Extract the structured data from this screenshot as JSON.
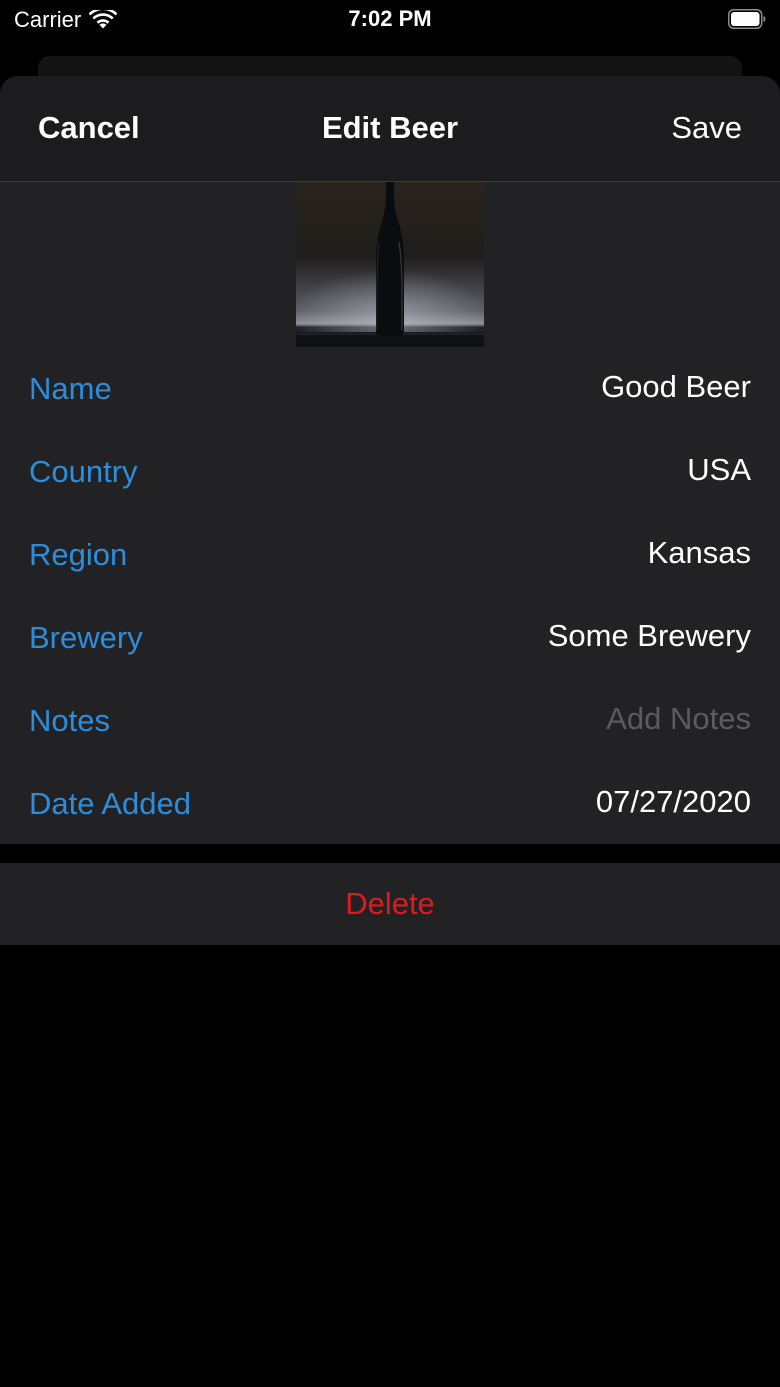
{
  "status_bar": {
    "carrier": "Carrier",
    "time": "7:02 PM",
    "wifi_icon": "wifi-icon",
    "battery_icon": "battery-icon"
  },
  "nav": {
    "cancel_label": "Cancel",
    "title": "Edit Beer",
    "save_label": "Save"
  },
  "photo": {
    "description_icon": "beer-bottle-photo"
  },
  "fields": [
    {
      "label": "Name",
      "value": "Good Beer",
      "placeholder": ""
    },
    {
      "label": "Country",
      "value": "USA",
      "placeholder": ""
    },
    {
      "label": "Region",
      "value": "Kansas",
      "placeholder": ""
    },
    {
      "label": "Brewery",
      "value": "Some Brewery",
      "placeholder": ""
    },
    {
      "label": "Notes",
      "value": "",
      "placeholder": "Add Notes"
    },
    {
      "label": "Date Added",
      "value": "07/27/2020",
      "placeholder": ""
    }
  ],
  "delete": {
    "label": "Delete"
  },
  "colors": {
    "accent": "#2c8ddb",
    "destructive": "#e0191f",
    "background": "#000000",
    "group_background": "#222224",
    "nav_background": "#1c1c1e"
  }
}
